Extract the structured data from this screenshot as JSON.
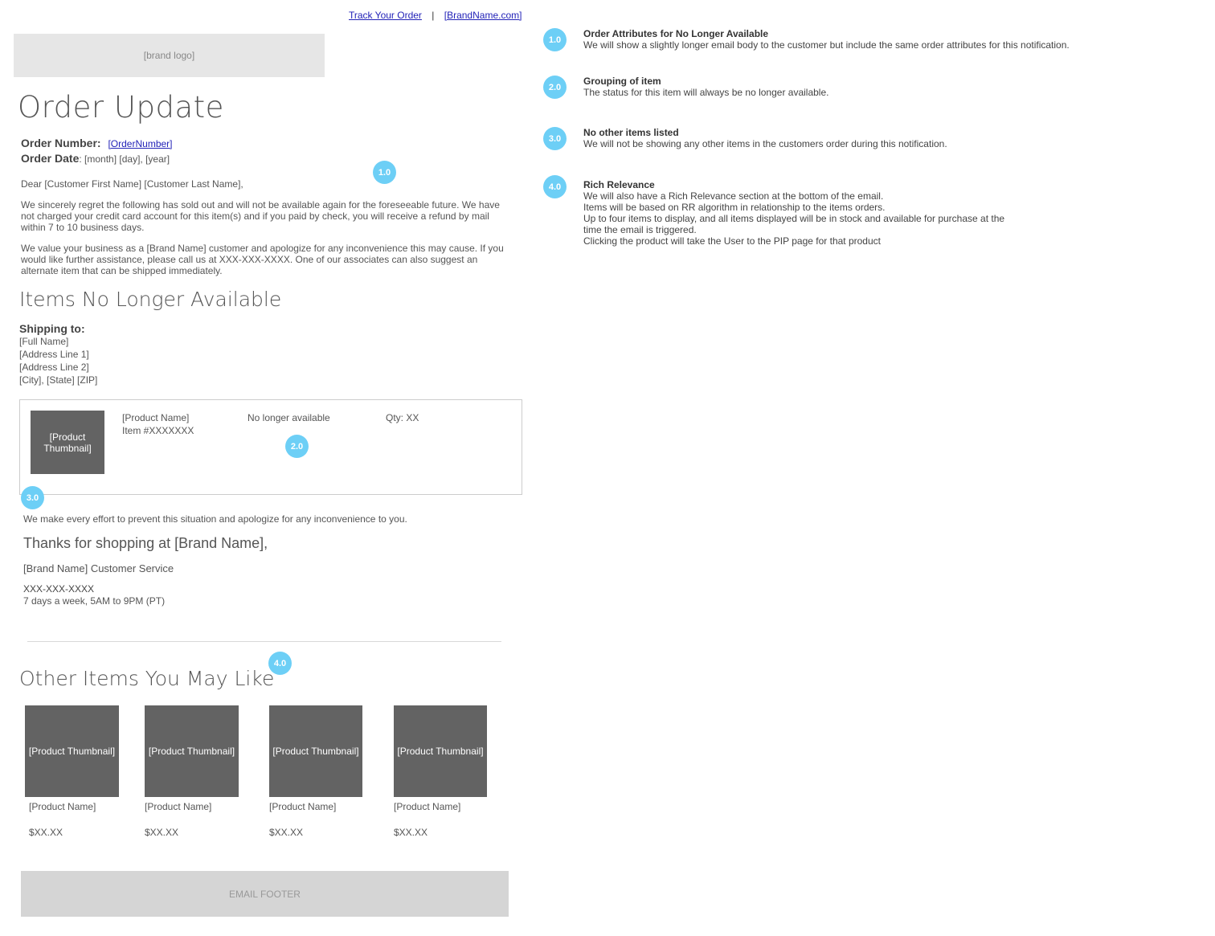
{
  "header": {
    "track_order": "Track Your Order",
    "separator": "|",
    "brand_site": "[BrandName.com]",
    "logo_text": "[brand logo]"
  },
  "title": "Order Update",
  "order": {
    "number_label": "Order Number:",
    "number_value": "[OrderNumber]",
    "date_label": "Order Date",
    "date_value": ": [month] [day], [year]"
  },
  "body": {
    "greeting": "Dear [Customer First Name] [Customer Last Name],",
    "para1": "We sincerely regret the following has sold out and will not be available again for the foreseeable future.  We have not charged your credit card account for this item(s) and if you paid by check, you will receive a refund by mail within 7 to 10 business days.",
    "para2": "We value your business as a [Brand Name] customer and apologize for any inconvenience this may cause. If you would like further assistance, please call us at XXX-XXX-XXXX. One of our associates can also suggest an alternate item that can be shipped immediately."
  },
  "unavailable": {
    "heading": "Items No Longer Available",
    "ship_label": "Shipping to:",
    "address": [
      "[Full Name]",
      "[Address Line 1]",
      "[Address Line 2]",
      "[City], [State] [ZIP]"
    ],
    "item": {
      "thumb": "[Product Thumbnail]",
      "name": "[Product Name]",
      "sku": "Item #XXXXXXX",
      "status": "No longer available",
      "qty": "Qty: XX"
    }
  },
  "closing": {
    "apology": "We make every effort to prevent this situation and apologize for any inconvenience to you.",
    "thanks": "Thanks for shopping at [Brand Name],",
    "signature": "[Brand Name] Customer Service",
    "phone": "XXX-XXX-XXXX",
    "hours": "7 days a week, 5AM to 9PM (PT)"
  },
  "recommendations": {
    "heading": "Other Items You May Like",
    "items": [
      {
        "thumb": "[Product Thumbnail]",
        "name": "[Product Name]",
        "price": "$XX.XX"
      },
      {
        "thumb": "[Product Thumbnail]",
        "name": "[Product Name]",
        "price": "$XX.XX"
      },
      {
        "thumb": "[Product Thumbnail]",
        "name": "[Product Name]",
        "price": "$XX.XX"
      },
      {
        "thumb": "[Product Thumbnail]",
        "name": "[Product Name]",
        "price": "$XX.XX"
      }
    ]
  },
  "footer": "EMAIL FOOTER",
  "markers": {
    "m1": "1.0",
    "m2": "2.0",
    "m3": "3.0",
    "m4": "4.0"
  },
  "notes": [
    {
      "num": "1.0",
      "title": "Order Attributes for No Longer Available",
      "lines": [
        "We will show a slightly longer email body to the customer but include the same order attributes for this notification."
      ]
    },
    {
      "num": "2.0",
      "title": "Grouping of item",
      "lines": [
        "The status for this item will always be no longer available."
      ]
    },
    {
      "num": "3.0",
      "title": "No other items listed",
      "lines": [
        "We will not be showing any other items in the customers order during this notification."
      ]
    },
    {
      "num": "4.0",
      "title": "Rich Relevance",
      "lines": [
        "We will also have a Rich Relevance section at the bottom of the email.",
        "Items will be based on RR algorithm in relationship to the items orders.",
        "Up to four items to display, and all items displayed will be in stock and available for purchase at the",
        "time the email is triggered.",
        "Clicking the product will take the User to the PIP page for that product"
      ]
    }
  ],
  "colors": {
    "badge": "#6dcff6",
    "thumbnail": "#636363",
    "footer_bg": "#d5d5d5",
    "logo_bg": "#e6e6e6",
    "link": "#2323b8"
  }
}
